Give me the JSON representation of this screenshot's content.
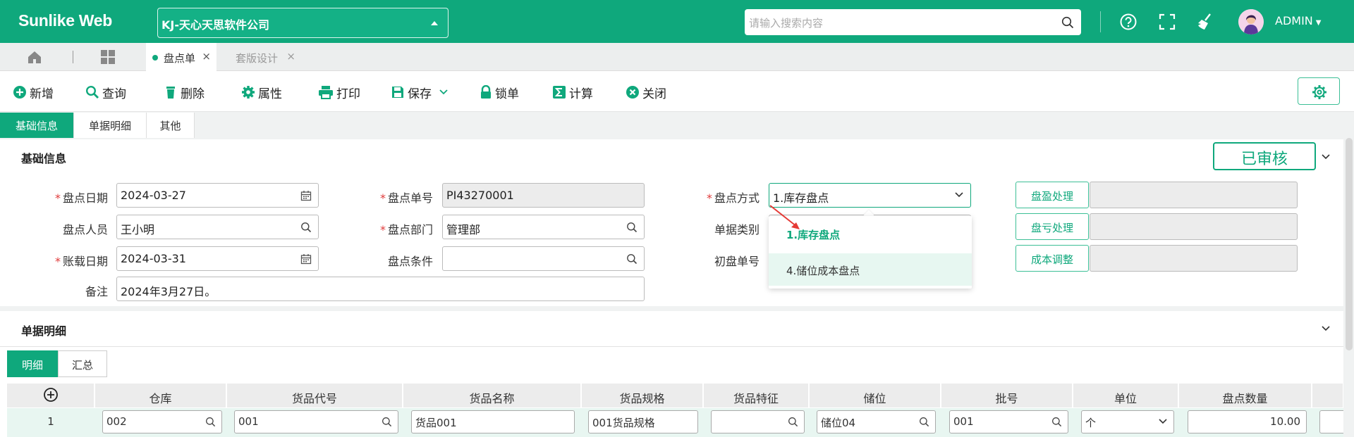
{
  "app": {
    "brand": "Sunlike Web",
    "company": "KJ-天心天思软件公司",
    "search_placeholder": "请输入搜索内容",
    "user": "ADMIN"
  },
  "tabs": {
    "active": "盘点单",
    "second": "套版设计",
    "close": "×"
  },
  "toolbar": {
    "new": "新增",
    "query": "查询",
    "delete": "删除",
    "props": "属性",
    "print": "打印",
    "save": "保存",
    "lock": "锁单",
    "calc": "计算",
    "close": "关闭"
  },
  "main_tabs": [
    "基础信息",
    "单据明细",
    "其他"
  ],
  "section1": {
    "title": "基础信息",
    "status": "已审核",
    "fields": {
      "date_label": "盘点日期",
      "date_value": "2024-03-27",
      "person_label": "盘点人员",
      "person_value": "王小明",
      "book_date_label": "账载日期",
      "book_date_value": "2024-03-31",
      "remark_label": "备注",
      "remark_value": "2024年3月27日。",
      "no_label": "盘点单号",
      "no_value": "PI43270001",
      "dept_label": "盘点部门",
      "dept_value": "管理部",
      "cond_label": "盘点条件",
      "cond_value": "",
      "method_label": "盘点方式",
      "method_value": "1.库存盘点",
      "type_label": "单据类别",
      "first_no_label": "初盘单号"
    },
    "side_buttons": [
      "盘盈处理",
      "盘亏处理",
      "成本调整"
    ],
    "dropdown_options": [
      "1.库存盘点",
      "4.储位成本盘点"
    ]
  },
  "section2": {
    "title": "单据明细",
    "subtabs": [
      "明细",
      "汇总"
    ],
    "columns": [
      "仓库",
      "货品代号",
      "货品名称",
      "货品规格",
      "货品特征",
      "储位",
      "批号",
      "单位",
      "盘点数量"
    ],
    "row": {
      "index": "1",
      "warehouse": "002",
      "code": "001",
      "name": "货品001",
      "spec": "001货品规格",
      "feature": "",
      "location": "储位04",
      "batch": "001",
      "unit": "个",
      "qty": "10.00"
    }
  },
  "colors": {
    "accent": "#0fa87c",
    "required": "#e03b3b",
    "annotation_arrow": "#e53935"
  }
}
